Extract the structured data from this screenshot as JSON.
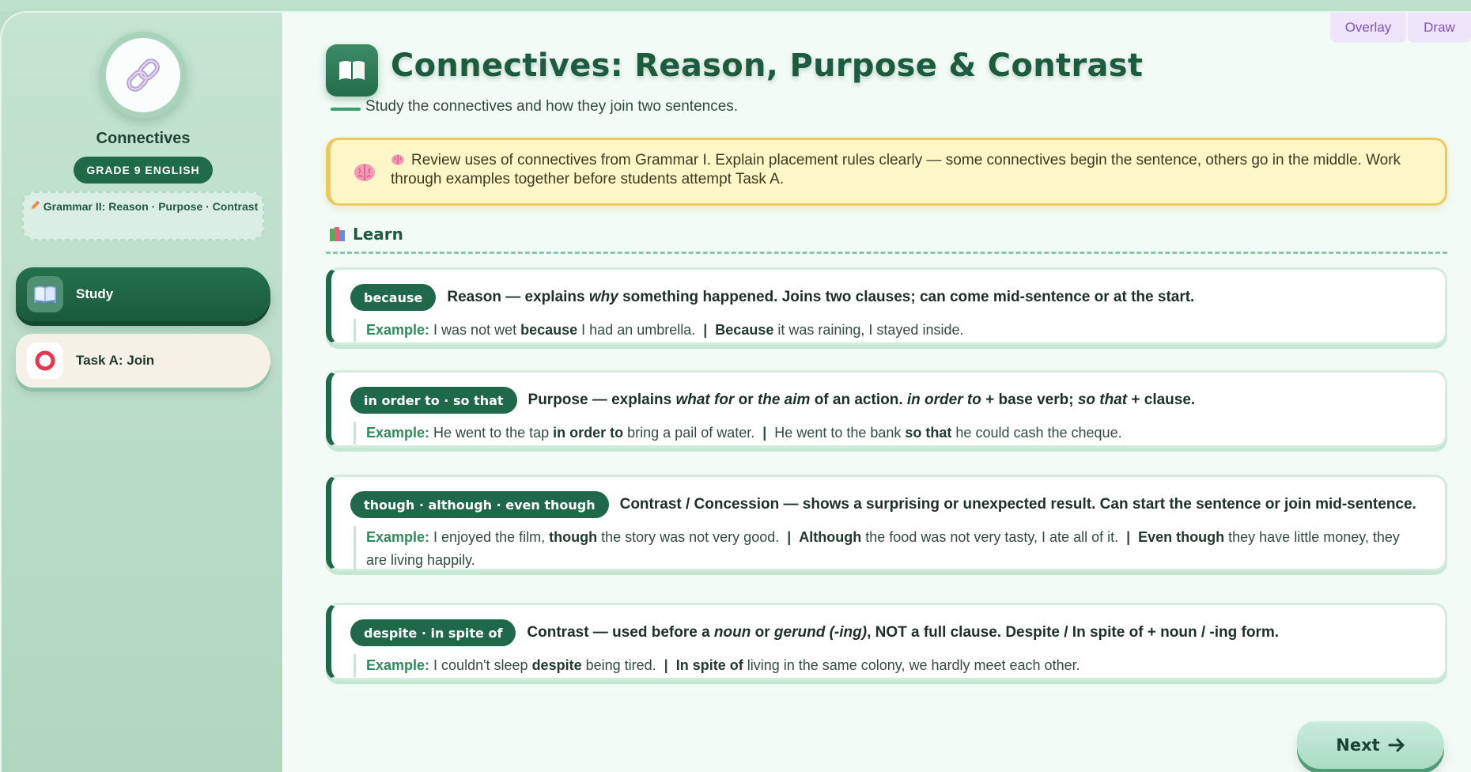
{
  "tools": {
    "overlay": "Overlay",
    "draw": "Draw"
  },
  "sidebar": {
    "logo_icon": "link-icon",
    "title": "Connectives",
    "grade": "GRADE 9 ENGLISH",
    "lesson": "Grammar II: Reason · Purpose · Contrast",
    "items": [
      {
        "label": "Study",
        "icon": "book-icon",
        "active": true
      },
      {
        "label": "Task A: Join",
        "icon": "ring-icon",
        "active": false
      }
    ]
  },
  "main": {
    "title": "Connectives: Reason, Purpose & Contrast",
    "subtitle": "Study the connectives and how they join two sentences.",
    "note": "Review uses of connectives from Grammar I. Explain placement rules clearly — some connectives begin the sentence, others go in the middle. Work through examples together before students attempt Task A.",
    "section": "Learn"
  },
  "cards": [
    {
      "chip": "because",
      "desc": {
        "a": "Reason — explains ",
        "b": "why",
        "c": " something happened. Joins two clauses; can come mid-sentence or at the start."
      },
      "example_label": "Example:",
      "ex1": {
        "a": " I was not wet ",
        "b": "because",
        "c": " I had an umbrella."
      },
      "ex2": {
        "b": "Because",
        "c": " it was raining, I stayed inside."
      }
    },
    {
      "chip": "in order to · so that",
      "desc": {
        "a": "Purpose — explains ",
        "b": "what for",
        "c": " or ",
        "d": "the aim",
        "e": " of an action. ",
        "f": "in order to",
        "g": " + base verb; ",
        "h": "so that",
        "i": " + clause."
      },
      "example_label": "Example:",
      "ex1": {
        "a": " He went to the tap ",
        "b": "in order to",
        "c": " bring a pail of water."
      },
      "ex2": {
        "a": "He went to the bank ",
        "b": "so that",
        "c": " he could cash the cheque."
      }
    },
    {
      "chip": "though · although · even though",
      "desc": {
        "a": "Contrast / Concession — shows a surprising or unexpected result. Can start the sentence or join mid-sentence."
      },
      "example_label": "Example:",
      "ex1": {
        "a": " I enjoyed the film, ",
        "b": "though",
        "c": " the story was not very good."
      },
      "ex2": {
        "b": "Although",
        "c": " the food was not very tasty, I ate all of it."
      },
      "ex3": {
        "b": "Even though",
        "c": " they have little money, they are living happily."
      }
    },
    {
      "chip": "despite · in spite of",
      "desc": {
        "a": "Contrast — used before a ",
        "b": "noun",
        "c": " or ",
        "d": "gerund (-ing)",
        "e": ", NOT a full clause. Despite / In spite of + noun / -ing form."
      },
      "example_label": "Example:",
      "ex1": {
        "a": " I couldn't sleep ",
        "b": "despite",
        "c": " being tired."
      },
      "ex2": {
        "b": "In spite of",
        "c": " living in the same colony, we hardly meet each other."
      }
    }
  ],
  "separator": "|",
  "next_label": "Next",
  "colors": {
    "accent": "#20684a",
    "note_bg": "#fdf6c8",
    "note_border": "#eccb5c",
    "tool_text": "#8150b8"
  }
}
